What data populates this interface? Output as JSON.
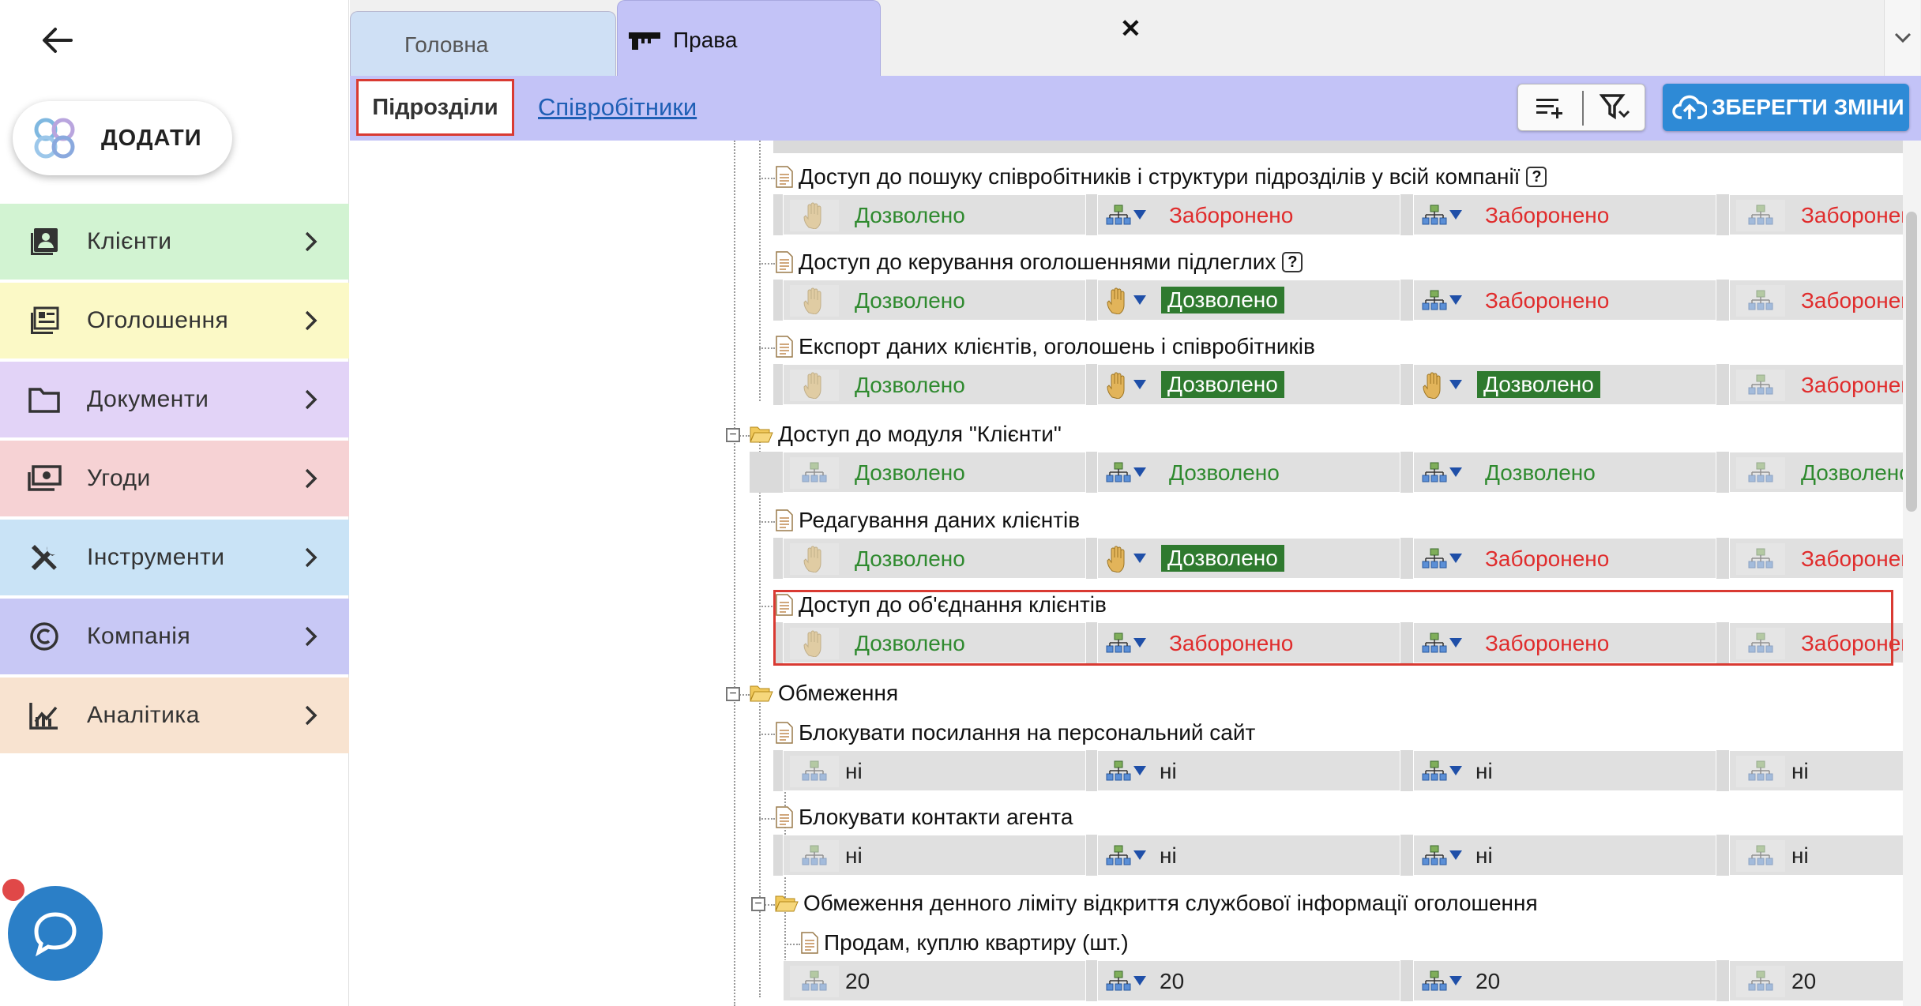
{
  "sidebar": {
    "add_label": "ДОДАТИ",
    "items": [
      {
        "label": "Клієнти",
        "icon": "contacts-icon",
        "color": "#d2f3d2"
      },
      {
        "label": "Оголошення",
        "icon": "listings-icon",
        "color": "#fbf9c6"
      },
      {
        "label": "Документи",
        "icon": "folder-icon",
        "color": "#e2d3f7"
      },
      {
        "label": "Угоди",
        "icon": "money-icon",
        "color": "#f6d2d4"
      },
      {
        "label": "Інструменти",
        "icon": "tools-icon",
        "color": "#c9e3f6"
      },
      {
        "label": "Компанія",
        "icon": "copyright-icon",
        "color": "#c8c8f5"
      },
      {
        "label": "Аналітика",
        "icon": "analytics-icon",
        "color": "#f8e3d0"
      }
    ]
  },
  "tabs": {
    "home": "Головна",
    "rights": "Права",
    "close": "✕"
  },
  "subtabs": {
    "units": "Підрозділи",
    "staff": "Співробітники"
  },
  "toolbar": {
    "save_label": "ЗБЕРЕГТИ ЗМІНИ"
  },
  "colors": {
    "accent": "#c3c3f7",
    "save": "#2e8ad6",
    "allowed": "#2f8a2f",
    "denied": "#e02c2c",
    "highlight": "#d93a32"
  },
  "tree": {
    "rows": [
      {
        "label": "Доступ до пошуку співробітників і структури підрозділів у всій компанії",
        "help": "?",
        "values": [
          "Дозволено",
          "Заборонено",
          "Заборонено",
          "Заборонен"
        ]
      },
      {
        "label": "Доступ до керування оголошеннями підлеглих",
        "help": "?",
        "values": [
          "Дозволено",
          "Дозволено",
          "Заборонено",
          "Заборонен"
        ]
      },
      {
        "label": "Експорт даних клієнтів, оголошень і співробітників",
        "values": [
          "Дозволено",
          "Дозволено",
          "Дозволено",
          "Заборонен"
        ]
      },
      {
        "label": "Доступ до модуля \"Клієнти\"",
        "values": [
          "Дозволено",
          "Дозволено",
          "Дозволено",
          "Дозволено"
        ]
      },
      {
        "label": "Редагування даних клієнтів",
        "values": [
          "Дозволено",
          "Дозволено",
          "Заборонено",
          "Заборонен"
        ]
      },
      {
        "label": "Доступ до об'єднання клієнтів",
        "values": [
          "Дозволено",
          "Заборонено",
          "Заборонено",
          "Заборонен"
        ]
      },
      {
        "label": "Обмеження"
      },
      {
        "label": "Блокувати посилання на персональний сайт",
        "values": [
          "ні",
          "ні",
          "ні",
          "ні"
        ]
      },
      {
        "label": "Блокувати контакти агента",
        "values": [
          "ні",
          "ні",
          "ні",
          "ні"
        ]
      },
      {
        "label": "Обмеження денного ліміту відкриття службової інформації оголошення"
      },
      {
        "label": "Продам, куплю квартиру (шт.)",
        "values": [
          "20",
          "20",
          "20",
          "20"
        ]
      }
    ]
  }
}
